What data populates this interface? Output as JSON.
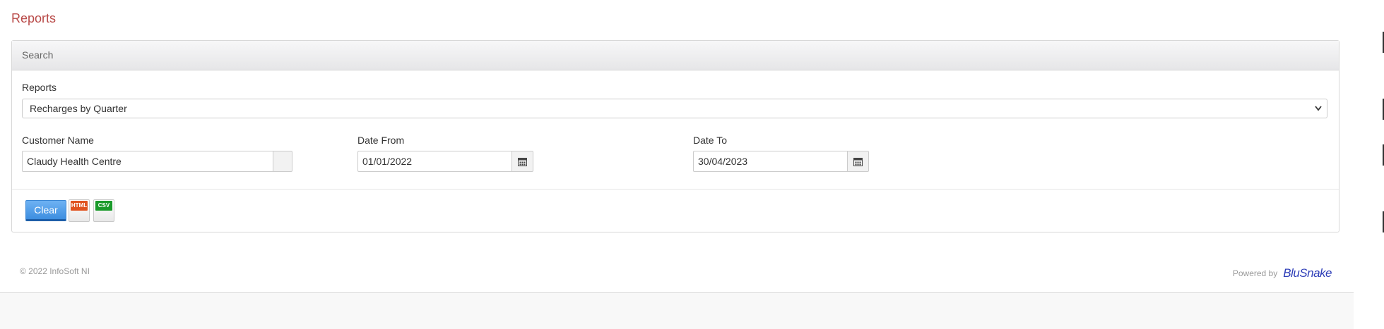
{
  "page": {
    "title": "Reports"
  },
  "panel": {
    "heading": "Search",
    "reports": {
      "label": "Reports",
      "selected": "Recharges by Quarter"
    },
    "customer": {
      "label": "Customer Name",
      "value": "Claudy Health Centre"
    },
    "date_from": {
      "label": "Date From",
      "value": "01/01/2022"
    },
    "date_to": {
      "label": "Date To",
      "value": "30/04/2023"
    },
    "actions": {
      "clear_label": "Clear",
      "html_label": "HTML",
      "csv_label": "CSV"
    }
  },
  "footer": {
    "copyright": "© 2022 InfoSoft NI",
    "powered_by": "Powered by",
    "brand": "BluSnake"
  },
  "colors": {
    "title": "#b94a48",
    "clear_button": "#4a97e6",
    "html_icon": "#e0521f",
    "csv_icon": "#1a9a2a",
    "brand": "#2f3fb8"
  }
}
